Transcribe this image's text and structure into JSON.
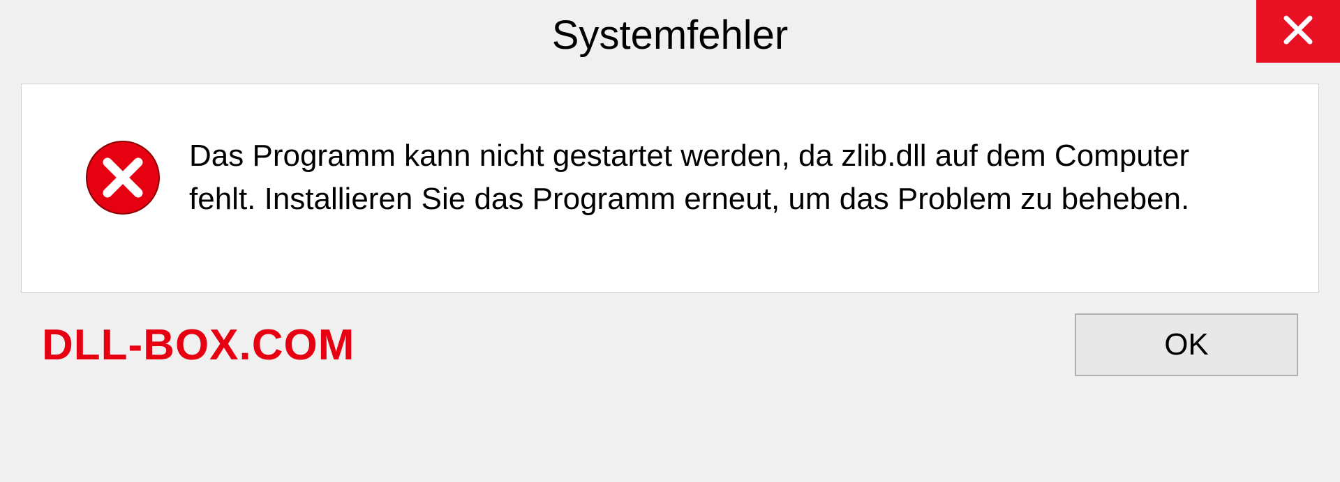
{
  "dialog": {
    "title": "Systemfehler",
    "message": "Das Programm kann nicht gestartet werden, da zlib.dll auf dem Computer fehlt. Installieren Sie das Programm erneut, um das Problem zu beheben.",
    "ok_label": "OK"
  },
  "watermark": "DLL-BOX.COM"
}
